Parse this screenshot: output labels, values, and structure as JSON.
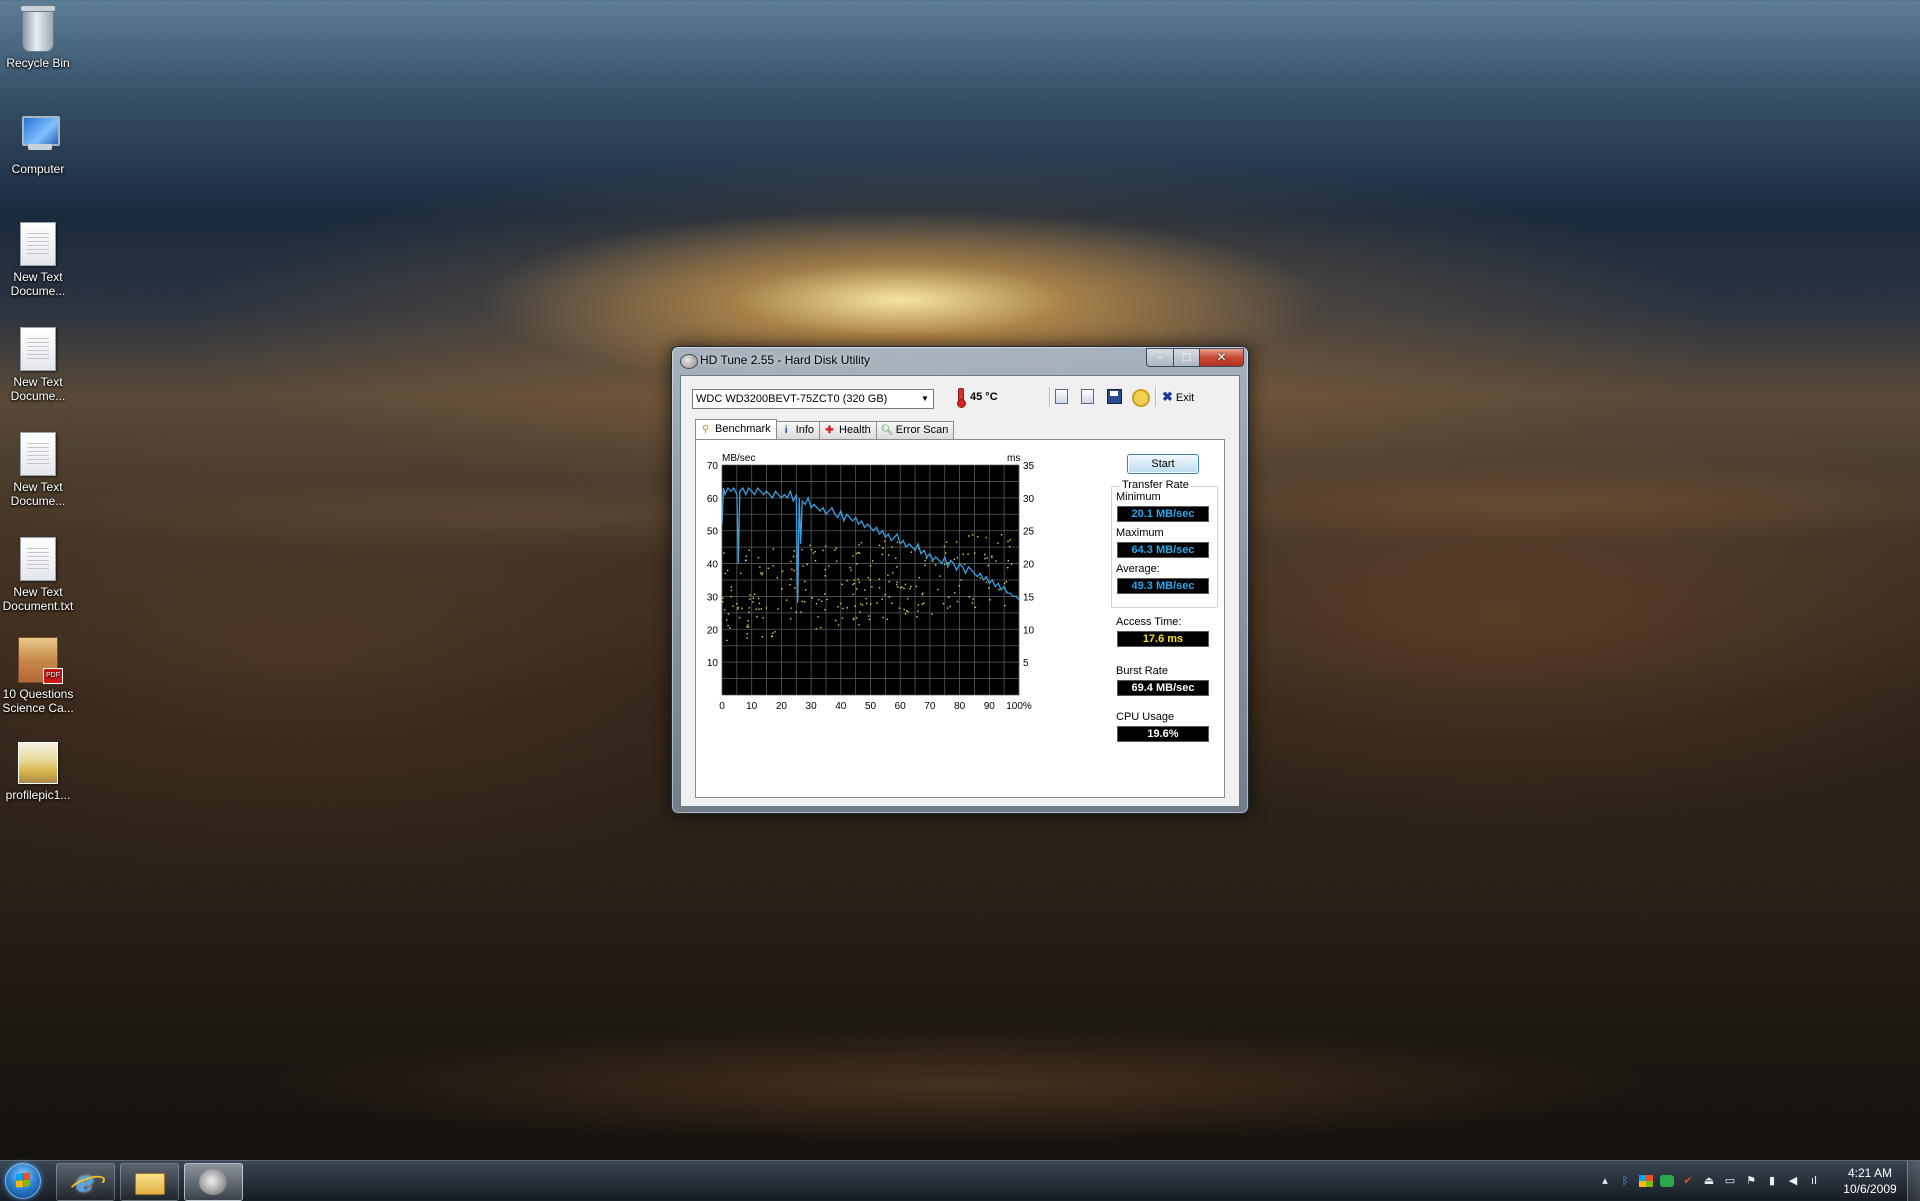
{
  "desktop": {
    "icons": [
      {
        "label_line1": "Recycle Bin",
        "label_line2": "",
        "icon": "recycle-bin-icon"
      },
      {
        "label_line1": "Computer",
        "label_line2": "",
        "icon": "computer-icon"
      },
      {
        "label_line1": "New Text",
        "label_line2": "Docume...",
        "icon": "text-document-icon"
      },
      {
        "label_line1": "New Text",
        "label_line2": "Docume...",
        "icon": "text-document-icon"
      },
      {
        "label_line1": "New Text",
        "label_line2": "Docume...",
        "icon": "text-document-icon"
      },
      {
        "label_line1": "New Text",
        "label_line2": "Document.txt",
        "icon": "text-document-icon"
      },
      {
        "label_line1": "10 Questions",
        "label_line2": "Science Ca...",
        "icon": "pdf-document-icon"
      },
      {
        "label_line1": "profilepic1...",
        "label_line2": "",
        "icon": "image-file-icon"
      }
    ]
  },
  "window": {
    "title": "HD Tune 2.55 - Hard Disk Utility",
    "caption_min": "–",
    "caption_max": "□",
    "caption_close": "✕",
    "drive": "WDC WD3200BEVT-75ZCT0 (320 GB)",
    "temperature": "45 °C",
    "exit_label": "Exit",
    "tabs": [
      {
        "label": "Benchmark",
        "icon": "benchmark-icon",
        "active": true
      },
      {
        "label": "Info",
        "icon": "info-icon",
        "active": false
      },
      {
        "label": "Health",
        "icon": "health-icon",
        "active": false
      },
      {
        "label": "Error Scan",
        "icon": "error-scan-icon",
        "active": false
      }
    ],
    "start_label": "Start",
    "transfer_rate_label": "Transfer Rate",
    "minimum_label": "Minimum",
    "minimum_value": "20.1 MB/sec",
    "maximum_label": "Maximum",
    "maximum_value": "64.3 MB/sec",
    "average_label": "Average:",
    "average_value": "49.3 MB/sec",
    "access_time_label": "Access Time:",
    "access_time_value": "17.6 ms",
    "burst_rate_label": "Burst Rate",
    "burst_rate_value": "69.4 MB/sec",
    "cpu_usage_label": "CPU Usage",
    "cpu_usage_value": "19.6%"
  },
  "chart_data": {
    "type": "line",
    "ylabel_left": "MB/sec",
    "ylabel_right": "ms",
    "left_ticks": [
      "70",
      "60",
      "50",
      "40",
      "30",
      "20",
      "10"
    ],
    "right_ticks": [
      "35",
      "30",
      "25",
      "20",
      "15",
      "10",
      "5"
    ],
    "x_ticks": [
      "0",
      "10",
      "20",
      "30",
      "40",
      "50",
      "60",
      "70",
      "80",
      "90",
      "100%"
    ],
    "xlim": [
      0,
      100
    ],
    "ylim_left": [
      0,
      70
    ],
    "ylim_right": [
      0,
      35
    ],
    "grid": true,
    "colors": {
      "background": "#000000",
      "grid": "#5a5a5a",
      "transfer": "#3aa0e0",
      "access": "#d8d860"
    },
    "series": [
      {
        "name": "transfer",
        "x": [
          0,
          0.5,
          1,
          2,
          3,
          4,
          5,
          5.5,
          6,
          7,
          8,
          9,
          10,
          11,
          12,
          13,
          14,
          15,
          16,
          17,
          18,
          19,
          20,
          21,
          22,
          23,
          24,
          25,
          25.5,
          26,
          26.5,
          27,
          28,
          29,
          30,
          31,
          32,
          33,
          34,
          35,
          36,
          37,
          38,
          39,
          40,
          41,
          42,
          43,
          44,
          45,
          46,
          47,
          48,
          49,
          50,
          51,
          52,
          53,
          54,
          55,
          56,
          57,
          58,
          59,
          60,
          61,
          62,
          63,
          64,
          65,
          66,
          67,
          68,
          69,
          70,
          71,
          72,
          73,
          74,
          75,
          76,
          77,
          78,
          79,
          80,
          81,
          82,
          83,
          84,
          85,
          86,
          87,
          88,
          89,
          90,
          91,
          92,
          93,
          94,
          95,
          96,
          97,
          98,
          99,
          100
        ],
        "values": [
          52,
          63,
          61,
          63,
          62,
          63,
          61,
          40,
          62,
          63,
          61,
          63,
          62,
          61,
          63,
          62,
          61,
          62,
          61,
          60,
          62,
          61,
          60,
          61,
          60,
          62,
          59,
          61,
          28,
          60,
          46,
          59,
          58,
          60,
          57,
          58,
          57,
          56,
          57,
          55,
          56,
          57,
          55,
          54,
          56,
          53,
          55,
          54,
          53,
          54,
          52,
          53,
          51,
          52,
          51,
          50,
          51,
          49,
          50,
          48,
          49,
          47,
          48,
          49,
          46,
          47,
          45,
          46,
          45,
          44,
          46,
          43,
          44,
          42,
          43,
          41,
          42,
          41,
          40,
          42,
          39,
          41,
          40,
          38,
          40,
          39,
          37,
          39,
          38,
          37,
          36,
          37,
          35,
          36,
          34,
          35,
          33,
          34,
          32,
          33,
          31,
          31,
          30,
          30,
          29
        ]
      }
    ],
    "access_scatter": {
      "x_range": [
        0,
        100
      ],
      "left_ms_range": [
        8,
        22
      ],
      "right_ms_range": [
        14,
        25
      ],
      "count": 260
    }
  },
  "taskbar": {
    "buttons": [
      {
        "name": "internet-explorer",
        "active": false
      },
      {
        "name": "windows-explorer",
        "active": false
      },
      {
        "name": "hd-tune",
        "active": true
      }
    ],
    "tray_icons": [
      "show-hidden-icons-icon",
      "bluetooth-icon",
      "network-app-icon",
      "green-app-icon",
      "security-icon",
      "usb-icon",
      "monitor-icon",
      "action-center-icon",
      "network-icon",
      "volume-icon"
    ],
    "time": "4:21 AM",
    "date": "10/6/2009"
  }
}
